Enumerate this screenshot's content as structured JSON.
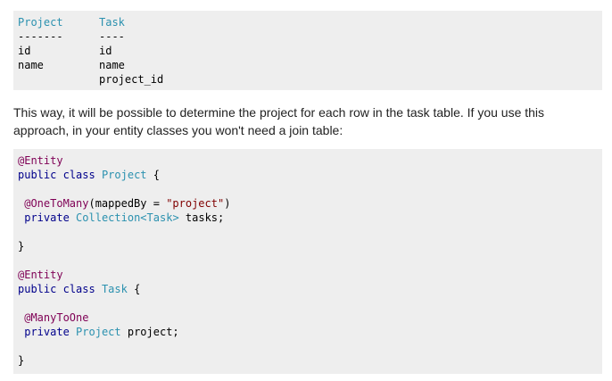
{
  "schema_block": {
    "headers": [
      "Project",
      "Task"
    ],
    "separators": [
      "-------",
      "----"
    ],
    "rows": [
      [
        "id",
        "id"
      ],
      [
        "name",
        "name"
      ],
      [
        "",
        "project_id"
      ]
    ]
  },
  "prose": {
    "text": "This way, it will be possible to determine the project for each row in the task table. If you use this approach, in your entity classes you won't need a join table:"
  },
  "java_block": {
    "project_class": {
      "annotation": "@Entity",
      "kw_public": "public",
      "kw_class": "class",
      "name": "Project",
      "open_brace": " {",
      "field_annotation": "@OneToMany",
      "field_annotation_args_start": "(mappedBy = ",
      "field_annotation_string": "\"project\"",
      "field_annotation_args_end": ")",
      "kw_private": "private",
      "field_type": "Collection",
      "generic_open": "<",
      "generic_type": "Task",
      "generic_close": ">",
      "field_name": " tasks;",
      "close_brace": "}"
    },
    "task_class": {
      "annotation": "@Entity",
      "kw_public": "public",
      "kw_class": "class",
      "name": "Task",
      "open_brace": " {",
      "field_annotation": "@ManyToOne",
      "kw_private": "private",
      "field_type": "Project",
      "field_name": " project;",
      "close_brace": "}"
    }
  },
  "colors": {
    "code_background": "#eeeeee",
    "type_color": "#2b91af",
    "annotation_color": "#7f0055",
    "keyword_color": "#00008b",
    "string_color": "#800000",
    "prose_color": "#222222"
  }
}
